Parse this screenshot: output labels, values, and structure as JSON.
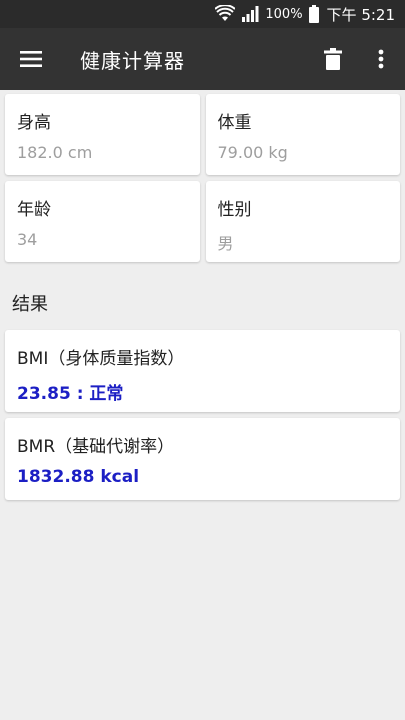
{
  "status_bar": {
    "battery_percent": "100%",
    "time": "下午 5:21"
  },
  "app_bar": {
    "title": "健康计算器",
    "menu_icon": "hamburger-menu-icon",
    "delete_icon": "trash-icon",
    "overflow_icon": "more-vert-icon"
  },
  "inputs": {
    "height": {
      "label": "身高",
      "value": "182.0 cm"
    },
    "weight": {
      "label": "体重",
      "value": "79.00 kg"
    },
    "age": {
      "label": "年龄",
      "value": "34"
    },
    "gender": {
      "label": "性别",
      "value": "男"
    }
  },
  "results": {
    "title": "结果",
    "bmi": {
      "label": "BMI（身体质量指数）",
      "value": "23.85 : 正常"
    },
    "bmr": {
      "label": "BMR（基础代谢率）",
      "value": "1832.88 kcal"
    }
  },
  "colors": {
    "app_bar": "#333333",
    "status_bar": "#2b2b2b",
    "background": "#eeeeee",
    "result_value": "#1c1fc4"
  }
}
